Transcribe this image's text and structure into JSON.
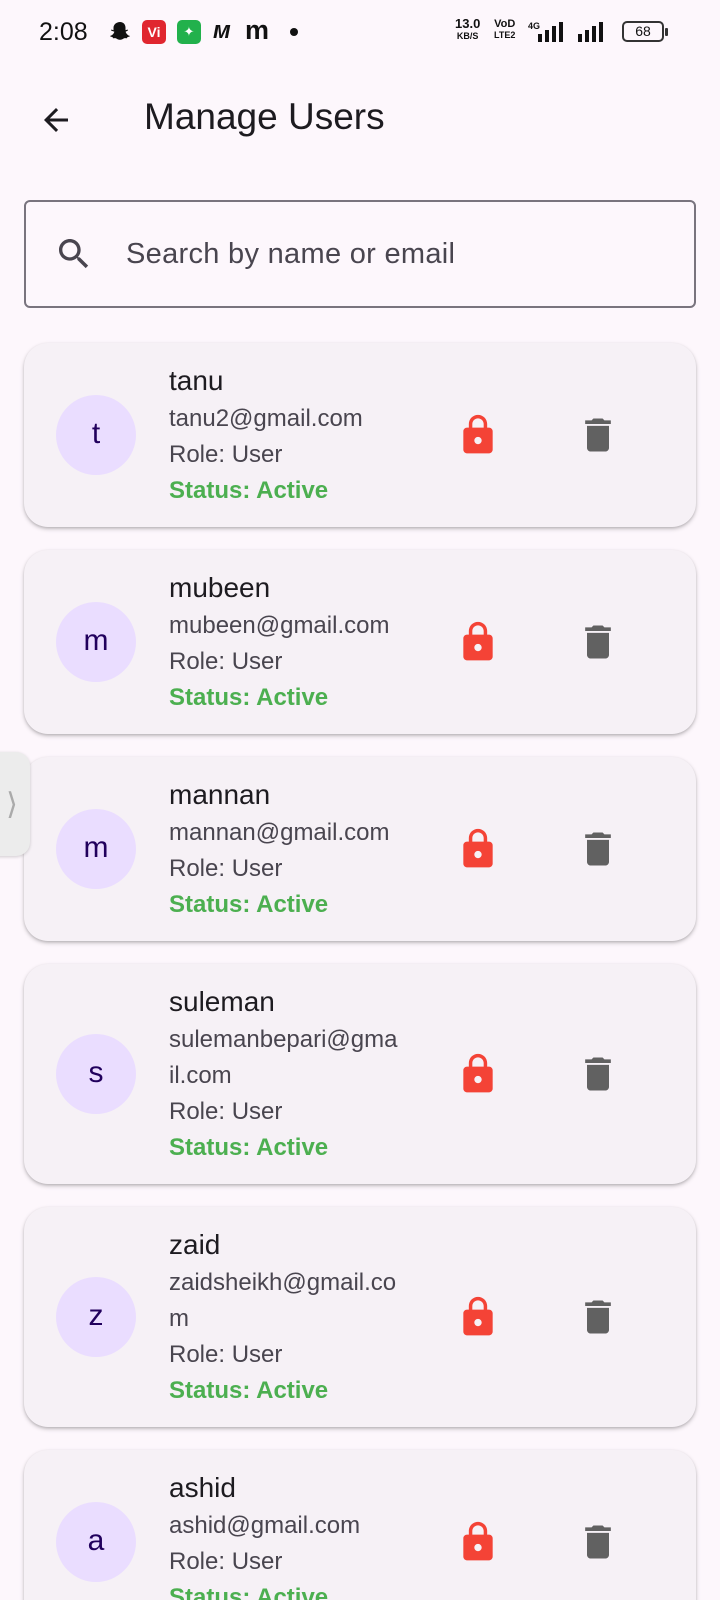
{
  "status_bar": {
    "time": "2:08",
    "vi_badge": "Vi",
    "speed_value": "13.0",
    "speed_unit": "KB/S",
    "volte_top": "VoD",
    "volte_bottom": "LTE2",
    "network": "4G",
    "battery": "68",
    "icons": [
      "snapchat-icon",
      "vi-app-icon",
      "store-app-icon",
      "m-app-icon",
      "m-app-icon",
      "dot-icon",
      "signal-icon",
      "battery-icon"
    ]
  },
  "app_bar": {
    "title": "Manage Users",
    "back_icon": "arrow-back-icon"
  },
  "search": {
    "placeholder": "Search by name or email",
    "value": ""
  },
  "colors": {
    "background": "#fdf7fc",
    "card": "#f6f1f6",
    "avatar_bg": "#eaddff",
    "status_active": "#4caf50",
    "lock_red": "#f44336",
    "delete_gray": "#616161"
  },
  "users": [
    {
      "initial": "t",
      "name": "tanu",
      "email": "tanu2@gmail.com",
      "role": "Role: User",
      "status": "Status: Active"
    },
    {
      "initial": "m",
      "name": "mubeen",
      "email": "mubeen@gmail.com",
      "role": "Role: User",
      "status": "Status: Active"
    },
    {
      "initial": "m",
      "name": "mannan",
      "email": "mannan@gmail.com",
      "role": "Role: User",
      "status": "Status: Active"
    },
    {
      "initial": "s",
      "name": "suleman",
      "email": "sulemanbepari@gmail.com",
      "role": "Role: User",
      "status": "Status: Active"
    },
    {
      "initial": "z",
      "name": "zaid",
      "email": "zaidsheikh@gmail.com",
      "role": "Role: User",
      "status": "Status: Active"
    },
    {
      "initial": "a",
      "name": "ashid",
      "email": "ashid@gmail.com",
      "role": "Role: User",
      "status": "Status: Active"
    }
  ],
  "side_handle": "⟩"
}
